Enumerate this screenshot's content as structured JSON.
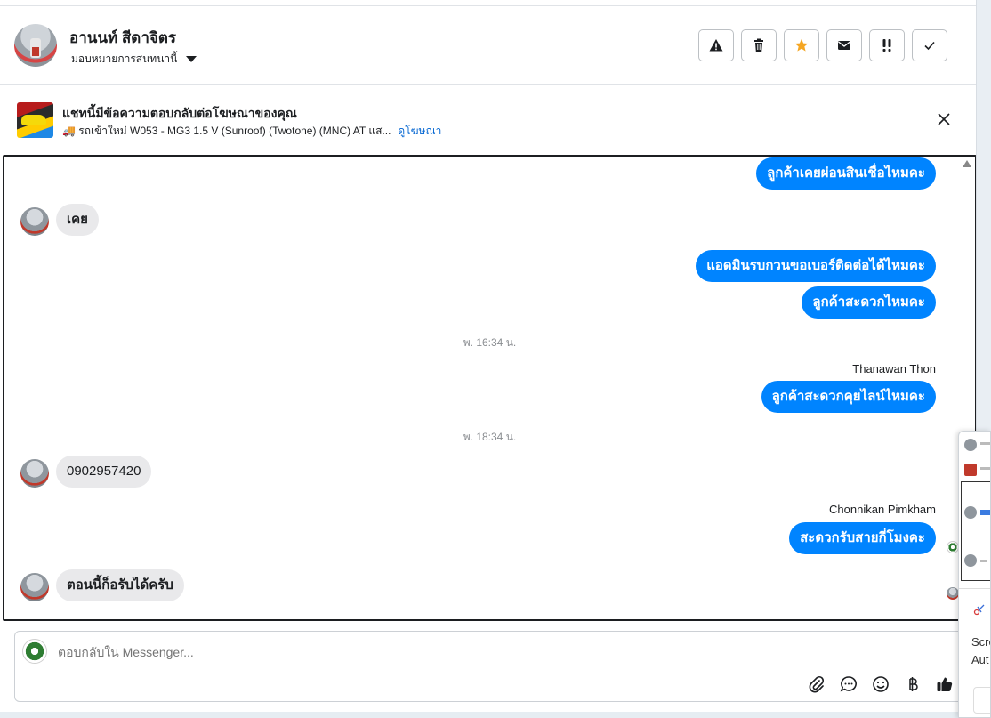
{
  "header": {
    "contact_name": "อานนท์ สีดาจิตร",
    "assign_label": "มอบหมายการสนทนานี้",
    "actions": [
      {
        "name": "report-spam-button",
        "icon": "warning-icon",
        "color": "#1c1e21"
      },
      {
        "name": "delete-button",
        "icon": "trash-icon",
        "color": "#1c1e21"
      },
      {
        "name": "star-button",
        "icon": "star-icon",
        "color": "#f5a623"
      },
      {
        "name": "mark-unread-button",
        "icon": "envelope-icon",
        "color": "#1c1e21"
      },
      {
        "name": "follow-up-button",
        "icon": "double-exclamation-icon",
        "color": "#1c1e21"
      },
      {
        "name": "mark-done-button",
        "icon": "checkmark-icon",
        "color": "#1c1e21"
      }
    ]
  },
  "banner": {
    "title": "แชทนี้มีข้อความตอบกลับต่อโฆษณาของคุณ",
    "subtitle": "🚚 รถเข้าใหม่ W053 - MG3 1.5 V (Sunroof) (Twotone) (MNC) AT แส...",
    "link": "ดูโฆษณา"
  },
  "messages": {
    "m1": "ลูกค้าเคยผ่อนสินเชื่อไหมคะ",
    "m2": "เคย",
    "m3": "แอดมินรบกวนขอเบอร์ติดต่อได้ไหมคะ",
    "m4": "ลูกค้าสะดวกไหมคะ",
    "ts1": "พ. 16:34 น.",
    "sender1": "Thanawan Thon",
    "m5": "ลูกค้าสะดวกคุยไลน์ไหมคะ",
    "ts2": "พ. 18:34 น.",
    "m6": "0902957420",
    "sender2": "Chonnikan Pimkham",
    "m7": "สะดวกรับสายกี่โมงคะ",
    "m8": "ตอนนี้ก็อรับได้ครับ"
  },
  "composer": {
    "placeholder": "ตอบกลับใน Messenger..."
  },
  "overlay": {
    "line1": "Scre",
    "line2": "Aut"
  },
  "colors": {
    "outgoing": "#0084ff",
    "incoming": "#e9e9eb",
    "link": "#0064d1"
  }
}
